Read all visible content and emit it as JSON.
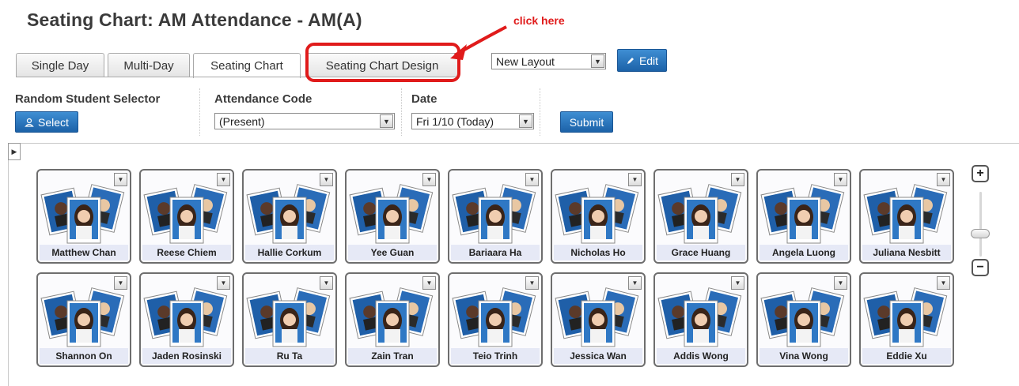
{
  "page": {
    "title": "Seating Chart: AM Attendance - AM(A)"
  },
  "annotation": {
    "text": "click here"
  },
  "tabs": [
    {
      "label": "Single Day"
    },
    {
      "label": "Multi-Day"
    },
    {
      "label": "Seating Chart",
      "active": true
    },
    {
      "label": "Seating Chart Design"
    }
  ],
  "layout_select": {
    "value": "New Layout"
  },
  "edit_button": {
    "label": "Edit",
    "icon": "pencil-icon"
  },
  "controls": {
    "random_selector": {
      "label": "Random Student Selector",
      "button": "Select",
      "icon": "user-icon"
    },
    "attendance_code": {
      "label": "Attendance Code",
      "value": "(Present)"
    },
    "date": {
      "label": "Date",
      "value": "Fri 1/10 (Today)"
    },
    "submit": {
      "label": "Submit"
    }
  },
  "zoom": {
    "in_label": "+",
    "out_label": "−",
    "level": 0.6
  },
  "students": [
    {
      "name": "Matthew Chan"
    },
    {
      "name": "Reese Chiem"
    },
    {
      "name": "Hallie Corkum"
    },
    {
      "name": "Yee Guan"
    },
    {
      "name": "Bariaara Ha"
    },
    {
      "name": "Nicholas Ho"
    },
    {
      "name": "Grace Huang"
    },
    {
      "name": "Angela Luong"
    },
    {
      "name": "Juliana Nesbitt"
    },
    {
      "name": "Shannon On"
    },
    {
      "name": "Jaden Rosinski"
    },
    {
      "name": "Ru Ta"
    },
    {
      "name": "Zain Tran"
    },
    {
      "name": "Teio Trinh"
    },
    {
      "name": "Jessica Wan"
    },
    {
      "name": "Addis Wong"
    },
    {
      "name": "Vina Wong"
    },
    {
      "name": "Eddie Xu"
    }
  ],
  "colors": {
    "accent_blue": "#2a74bd",
    "annotation_red": "#e01b1b",
    "name_bar": "#e6e9f6"
  }
}
